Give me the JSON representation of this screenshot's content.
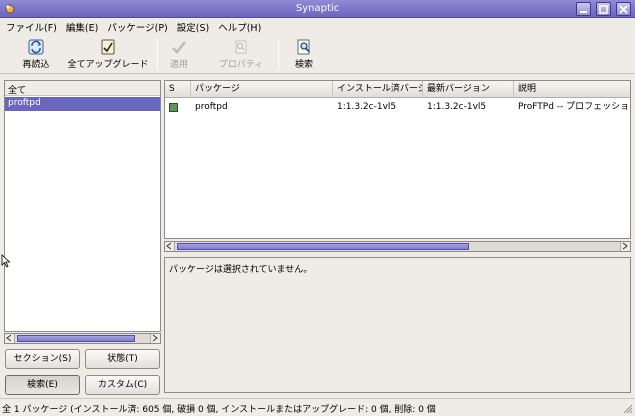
{
  "window": {
    "title": "Synaptic"
  },
  "menu": {
    "items": [
      {
        "label": "ファイル(F)"
      },
      {
        "label": "編集(E)"
      },
      {
        "label": "パッケージ(P)"
      },
      {
        "label": "設定(S)"
      },
      {
        "label": "ヘルプ(H)"
      }
    ]
  },
  "toolbar": {
    "reload": "再読込",
    "upgrade_all": "全てアップグレード",
    "apply": "適用",
    "properties": "プロパティ",
    "search": "検索"
  },
  "left_panel": {
    "header": "全て",
    "items": [
      "proftpd"
    ],
    "buttons": {
      "sections": "セクション(S)",
      "status": "状態(T)",
      "search": "検索(E)",
      "custom": "カスタム(C)"
    }
  },
  "package_list": {
    "columns": [
      "S",
      "パッケージ",
      "インストール済バージョン",
      "最新バージョン",
      "説明"
    ],
    "rows": [
      {
        "package": "proftpd",
        "installed": "1:1.3.2c-1vl5",
        "latest": "1:1.3.2c-1vl5",
        "description": "ProFTPd -- プロフェッショナル"
      }
    ]
  },
  "description": {
    "text": "パッケージは選択されていません。"
  },
  "statusbar": {
    "text": "全 1 パッケージ (インストール済: 605 個, 破損 0 個, インストールまたはアップグレード: 0 個, 削除: 0 個"
  },
  "colors": {
    "selection": "#6b66bd",
    "titlebar": "#7f7bcc",
    "status_installed": "#5f9654"
  }
}
